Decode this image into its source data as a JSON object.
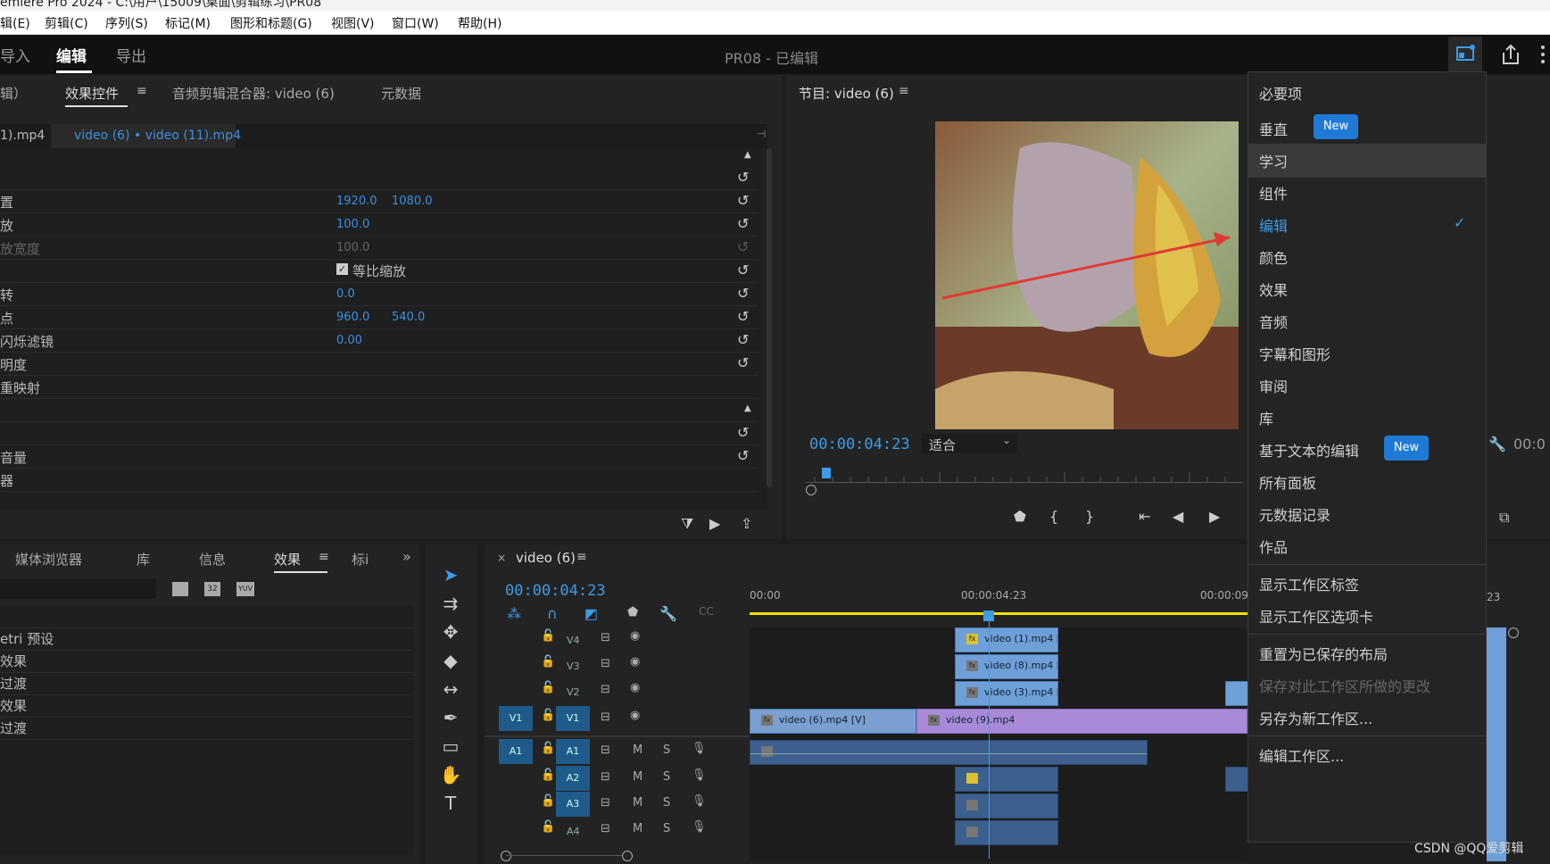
{
  "title_bar": "emiere Pro 2024 - C:\\用户\\15009\\桌面\\剪辑练习\\PR08",
  "menu": [
    "辑(E)",
    "剪辑(C)",
    "序列(S)",
    "标记(M)",
    "图形和标题(G)",
    "视图(V)",
    "窗口(W)",
    "帮助(H)"
  ],
  "workspace_tabs": [
    "导入",
    "编辑",
    "导出"
  ],
  "document_title": "PR08 - 已编辑",
  "effect_panel": {
    "tabs": [
      "辑）",
      "效果控件",
      "音频剪辑混合器: video (6)",
      "元数据"
    ],
    "source_clip": "1).mp4",
    "sequence_clip": "video (6) • video (11).mp4",
    "rows": [
      {
        "label": "",
        "v1": "",
        "v2": ""
      },
      {
        "label": "置",
        "v1": "1920.0",
        "v2": "1080.0"
      },
      {
        "label": "放",
        "v1": "100.0",
        "v2": ""
      },
      {
        "label": "放宽度",
        "v1": "100.0",
        "v2": ""
      },
      {
        "label": "",
        "v1": "",
        "v2": ""
      },
      {
        "label": "转",
        "v1": "0.0",
        "v2": ""
      },
      {
        "label": "点",
        "v1": "960.0",
        "v2": "540.0"
      },
      {
        "label": "闪烁滤镜",
        "v1": "0.00",
        "v2": ""
      },
      {
        "label": "明度",
        "v1": "",
        "v2": ""
      },
      {
        "label": "重映射",
        "v1": "",
        "v2": ""
      },
      {
        "label": "",
        "v1": "",
        "v2": ""
      },
      {
        "label": "",
        "v1": "",
        "v2": ""
      },
      {
        "label": "音量",
        "v1": "",
        "v2": ""
      },
      {
        "label": "器",
        "v1": "",
        "v2": ""
      }
    ],
    "uniform_scale_label": "等比缩放"
  },
  "program_monitor": {
    "title": "节目: video (6)",
    "timecode": "00:00:04:23",
    "fit": "适合",
    "right_timecode": "00:0"
  },
  "left_bottom_panel": {
    "tabs": [
      "媒体浏览器",
      "库",
      "信息",
      "效果",
      "标i"
    ],
    "icon_labels": [
      "32",
      "YUV"
    ],
    "items": [
      "",
      "etri 预设",
      "效果",
      "过渡",
      "效果",
      "过渡"
    ]
  },
  "timeline": {
    "title": "video (6)",
    "timecode": "00:00:04:23",
    "ruler": [
      "00:00",
      "00:00:04:23",
      "00:00:09",
      "23"
    ],
    "video_tracks": [
      "V4",
      "V3",
      "V2",
      "V1"
    ],
    "audio_tracks": [
      "A1",
      "A2",
      "A3",
      "A4"
    ],
    "source_target_video": "V1",
    "source_target_audio": "A1",
    "audio_m": "M",
    "audio_s": "S",
    "clips": {
      "v4": "video (1).mp4 [",
      "v3": "video (8).mp4 [",
      "v2": "video (3).mp4 [",
      "v1a": "video (6).mp4 [V]",
      "v1b": "video (9).mp4"
    },
    "fx_label": "fx"
  },
  "workspace_menu": {
    "items": [
      {
        "label": "必要项"
      },
      {
        "label": "垂直",
        "badge": "New"
      },
      {
        "label": "学习",
        "highlight": true
      },
      {
        "label": "组件"
      },
      {
        "label": "编辑",
        "checked": true
      },
      {
        "label": "颜色"
      },
      {
        "label": "效果"
      },
      {
        "label": "音频"
      },
      {
        "label": "字幕和图形"
      },
      {
        "label": "审阅"
      },
      {
        "label": "库"
      },
      {
        "label": "基于文本的编辑",
        "badge": "New"
      },
      {
        "label": "所有面板"
      },
      {
        "label": "元数据记录"
      },
      {
        "label": "作品"
      }
    ],
    "section2": [
      "显示工作区标签",
      "显示工作区选项卡"
    ],
    "section3": [
      "重置为已保存的布局",
      "保存对此工作区所做的更改",
      "另存为新工作区..."
    ],
    "section4": [
      "编辑工作区..."
    ]
  },
  "watermark": "CSDN @QQ爱剪辑",
  "colors": {
    "accent": "#3d8fe0",
    "badge": "#1f7ad6",
    "playhead": "#3d9be8",
    "work_area": "#f4e000"
  }
}
